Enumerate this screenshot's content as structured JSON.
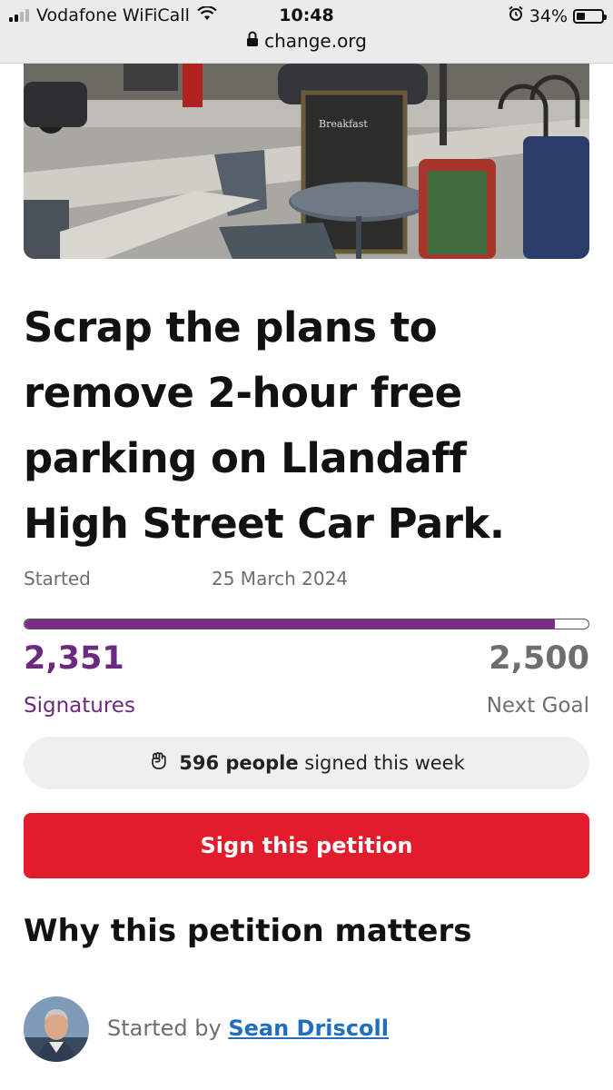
{
  "status_bar": {
    "carrier": "Vodafone WiFiCall",
    "time": "10:48",
    "battery": "34%",
    "battery_level": 0.34,
    "url": "change.org"
  },
  "petition": {
    "title": "Scrap the plans to remove 2-hour free parking on Llandaff High Street Car Park.",
    "started_label": "Started",
    "started_date": "25 March 2024",
    "progress_fraction": 0.94,
    "signatures_count": "2,351",
    "signatures_label": "Signatures",
    "next_goal_count": "2,500",
    "next_goal_label": "Next Goal",
    "weekly_count": "596 people",
    "weekly_text": "signed this week",
    "sign_button": "Sign this petition",
    "why_heading": "Why this petition matters",
    "started_by_label": "Started by",
    "author": "Sean Driscoll"
  },
  "icons": {
    "weekly": "fist-icon",
    "lock": "lock-icon"
  },
  "colors": {
    "purple": "#6b2a7e",
    "red": "#e21b2d",
    "link": "#1f6fbf"
  }
}
